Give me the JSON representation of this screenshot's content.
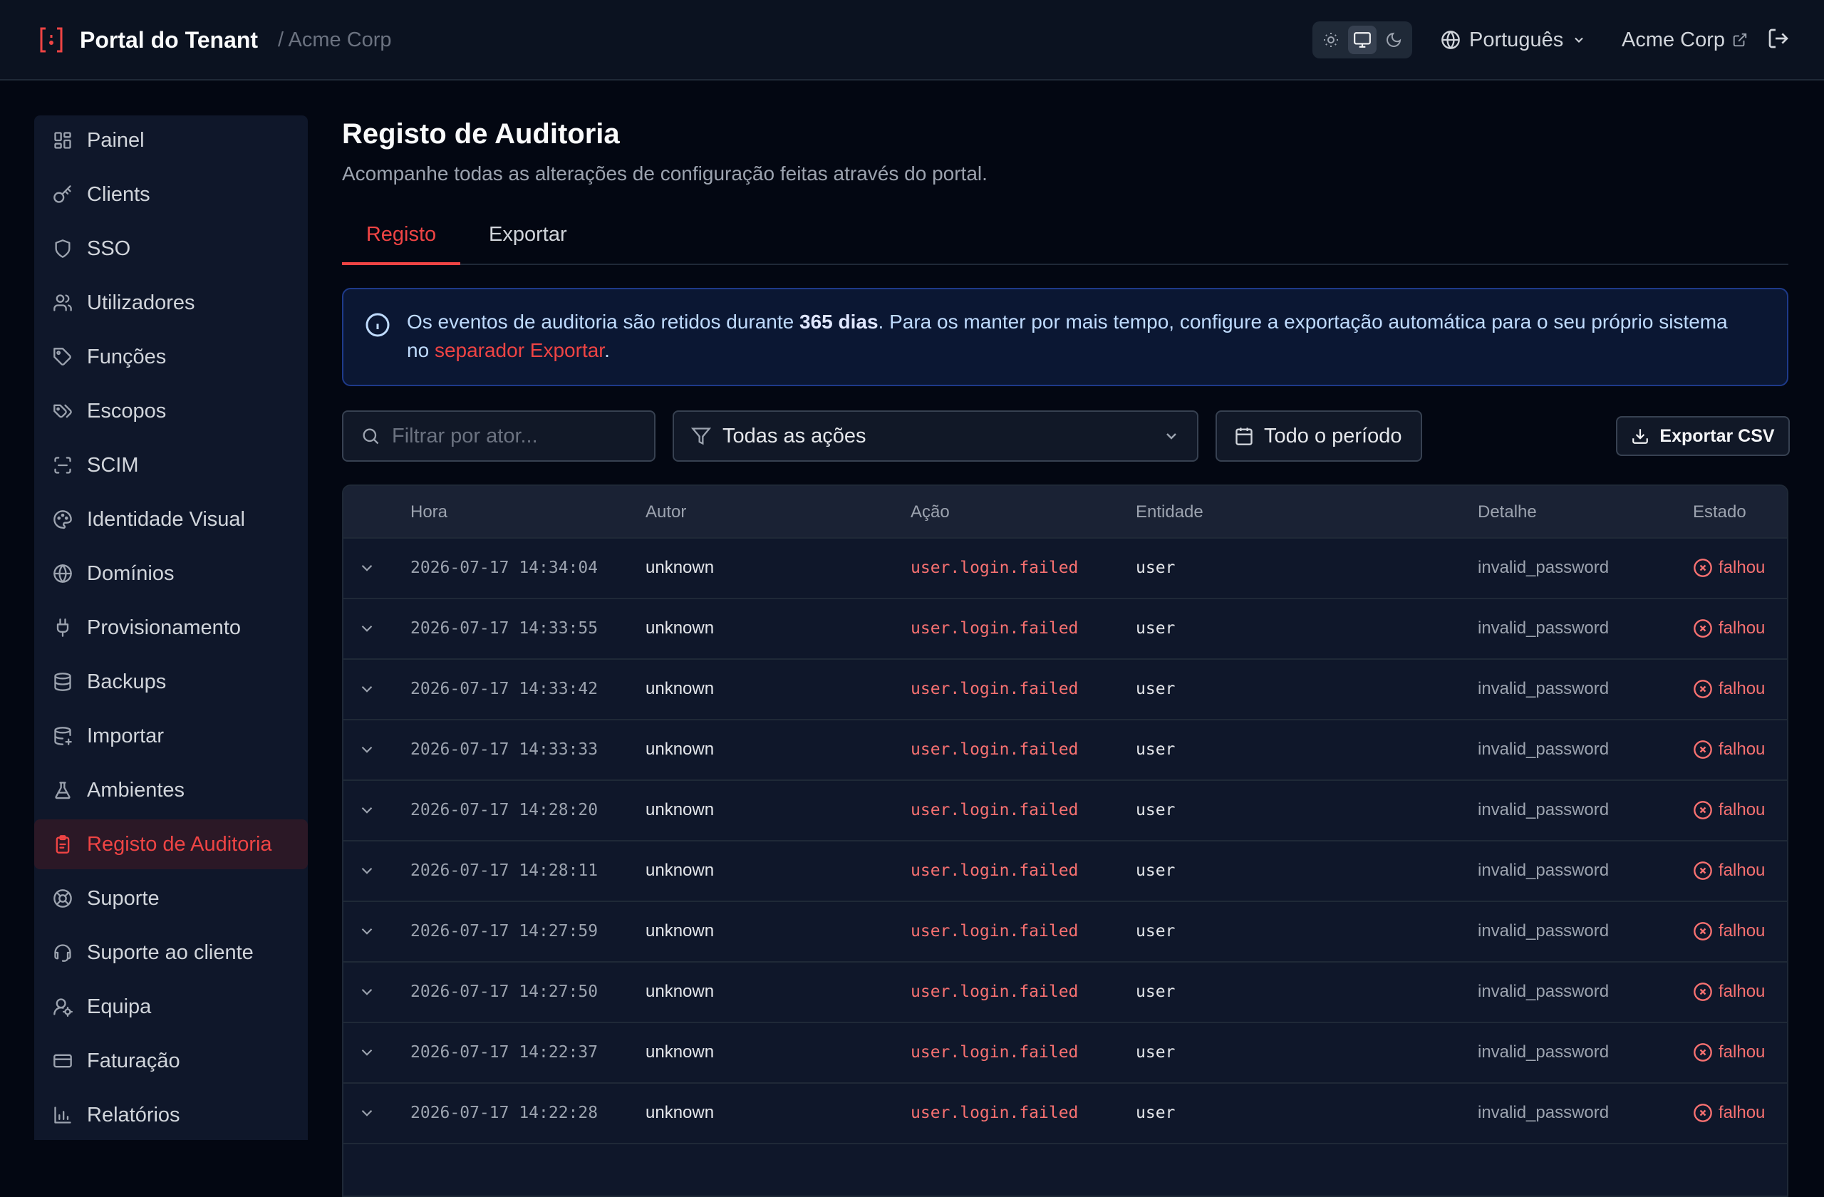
{
  "header": {
    "brand": "Portal do Tenant",
    "crumb": "/ Acme Corp",
    "language": "Português",
    "tenant_link": "Acme Corp",
    "theme_modes": [
      "sun-icon",
      "monitor-icon",
      "moon-icon"
    ],
    "theme_active": "monitor-icon"
  },
  "sidebar": {
    "items": [
      {
        "label": "Painel",
        "icon": "dashboard-icon"
      },
      {
        "label": "Clients",
        "icon": "key-icon"
      },
      {
        "label": "SSO",
        "icon": "shield-icon"
      },
      {
        "label": "Utilizadores",
        "icon": "users-icon"
      },
      {
        "label": "Funções",
        "icon": "tag-icon"
      },
      {
        "label": "Escopos",
        "icon": "tags-icon"
      },
      {
        "label": "SCIM",
        "icon": "scan-icon"
      },
      {
        "label": "Identidade Visual",
        "icon": "palette-icon"
      },
      {
        "label": "Domínios",
        "icon": "globe-icon"
      },
      {
        "label": "Provisionamento",
        "icon": "plug-icon"
      },
      {
        "label": "Backups",
        "icon": "database-icon"
      },
      {
        "label": "Importar",
        "icon": "database-import-icon"
      },
      {
        "label": "Ambientes",
        "icon": "flask-icon"
      },
      {
        "label": "Registo de Auditoria",
        "icon": "clipboard-icon"
      },
      {
        "label": "Suporte",
        "icon": "lifebuoy-icon"
      },
      {
        "label": "Suporte ao cliente",
        "icon": "headset-icon"
      },
      {
        "label": "Equipa",
        "icon": "user-cog-icon"
      },
      {
        "label": "Faturação",
        "icon": "credit-card-icon"
      },
      {
        "label": "Relatórios",
        "icon": "bar-chart-icon"
      }
    ],
    "active_index": 13
  },
  "main": {
    "title": "Registo de Auditoria",
    "subtitle": "Acompanhe todas as alterações de configuração feitas através do portal.",
    "tabs": [
      {
        "label": "Registo"
      },
      {
        "label": "Exportar"
      }
    ],
    "active_tab": 0,
    "info": {
      "text_before": "Os eventos de auditoria são retidos durante ",
      "bold": "365 dias",
      "text_middle": ". Para os manter por mais tempo, configure a exportação automática para o seu próprio sistema no ",
      "link": "separador Exportar",
      "text_after": "."
    },
    "filters": {
      "actor_placeholder": "Filtrar por ator...",
      "action_selected": "Todas as ações",
      "period": "Todo o período",
      "export_label": "Exportar CSV"
    },
    "table": {
      "columns": [
        "Hora",
        "Autor",
        "Ação",
        "Entidade",
        "Detalhe",
        "Estado"
      ],
      "rows": [
        {
          "time": "2026-07-17 14:34:04",
          "actor": "unknown",
          "action": "user.login.failed",
          "entity": "user",
          "detail": "invalid_password",
          "status": "falhou"
        },
        {
          "time": "2026-07-17 14:33:55",
          "actor": "unknown",
          "action": "user.login.failed",
          "entity": "user",
          "detail": "invalid_password",
          "status": "falhou"
        },
        {
          "time": "2026-07-17 14:33:42",
          "actor": "unknown",
          "action": "user.login.failed",
          "entity": "user",
          "detail": "invalid_password",
          "status": "falhou"
        },
        {
          "time": "2026-07-17 14:33:33",
          "actor": "unknown",
          "action": "user.login.failed",
          "entity": "user",
          "detail": "invalid_password",
          "status": "falhou"
        },
        {
          "time": "2026-07-17 14:28:20",
          "actor": "unknown",
          "action": "user.login.failed",
          "entity": "user",
          "detail": "invalid_password",
          "status": "falhou"
        },
        {
          "time": "2026-07-17 14:28:11",
          "actor": "unknown",
          "action": "user.login.failed",
          "entity": "user",
          "detail": "invalid_password",
          "status": "falhou"
        },
        {
          "time": "2026-07-17 14:27:59",
          "actor": "unknown",
          "action": "user.login.failed",
          "entity": "user",
          "detail": "invalid_password",
          "status": "falhou"
        },
        {
          "time": "2026-07-17 14:27:50",
          "actor": "unknown",
          "action": "user.login.failed",
          "entity": "user",
          "detail": "invalid_password",
          "status": "falhou"
        },
        {
          "time": "2026-07-17 14:22:37",
          "actor": "unknown",
          "action": "user.login.failed",
          "entity": "user",
          "detail": "invalid_password",
          "status": "falhou"
        },
        {
          "time": "2026-07-17 14:22:28",
          "actor": "unknown",
          "action": "user.login.failed",
          "entity": "user",
          "detail": "invalid_password",
          "status": "falhou"
        }
      ]
    }
  },
  "colors": {
    "accent": "#ef4444",
    "background": "#030712",
    "surface": "#0f172a",
    "info_border": "#1e3a8a"
  }
}
